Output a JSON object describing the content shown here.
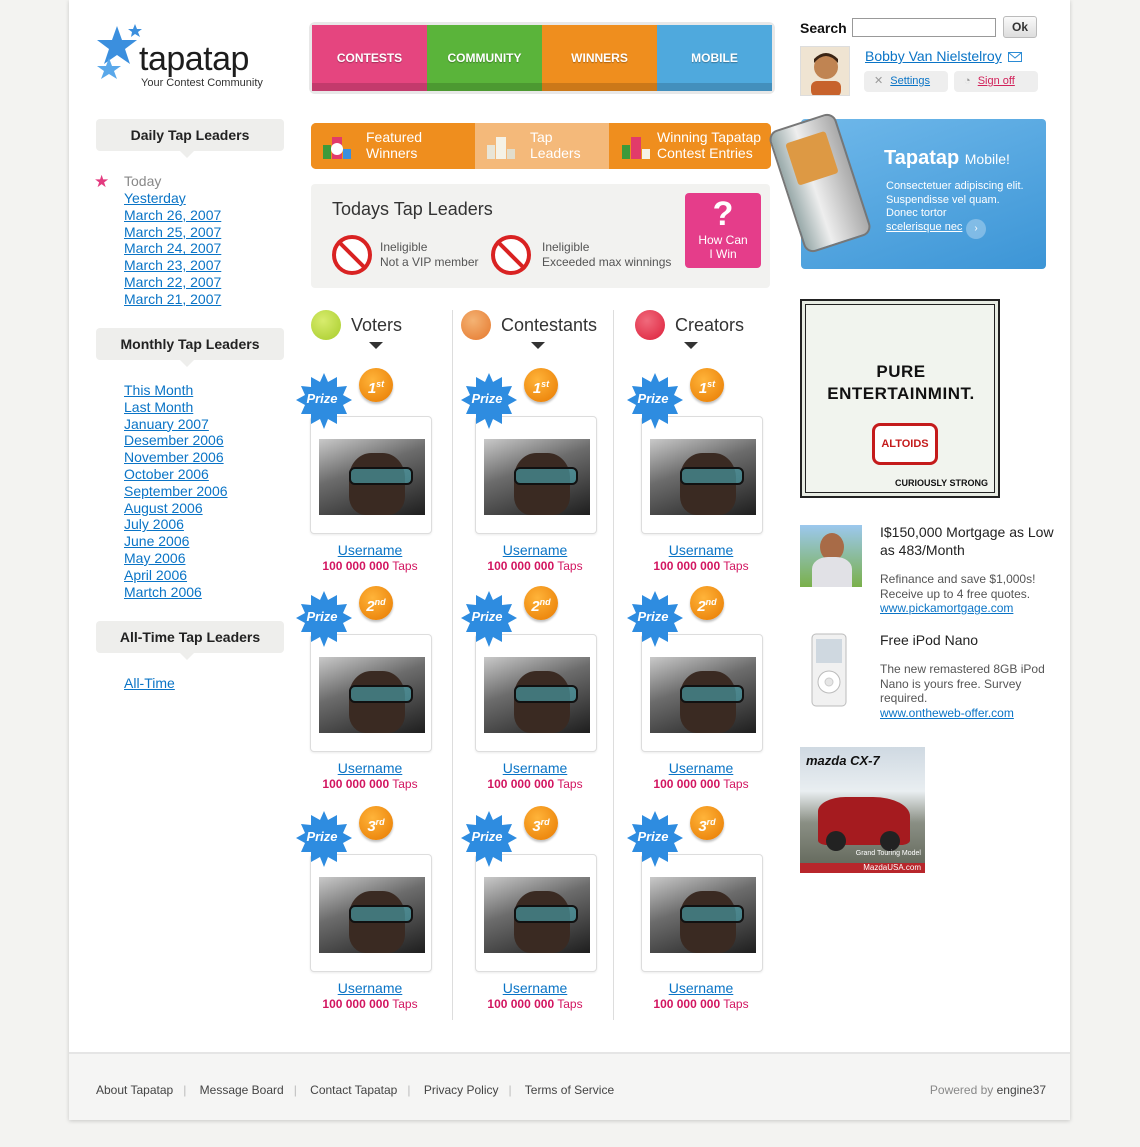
{
  "brand": {
    "name": "tapatap",
    "tagline": "Your Contest Community"
  },
  "nav": {
    "tabs": [
      {
        "label": "CONTESTS",
        "color": "#e5457f"
      },
      {
        "label": "COMMUNITY",
        "color": "#5ab43a"
      },
      {
        "label": "WINNERS",
        "color": "#ef8e1e"
      },
      {
        "label": "MOBILE",
        "color": "#4fa9dd"
      }
    ]
  },
  "header": {
    "search_label": "Search",
    "search_value": "",
    "ok_label": "Ok",
    "user_name": "Bobby Van Nielstelroy",
    "settings_label": "Settings",
    "signoff_label": "Sign off"
  },
  "sidebar": {
    "daily": {
      "title": "Daily Tap Leaders",
      "today": "Today",
      "links": [
        "Yesterday",
        "March 26, 2007",
        "March 25, 2007",
        "March 24, 2007",
        "March 23, 2007",
        "March 22, 2007",
        "March 21, 2007"
      ]
    },
    "monthly": {
      "title": "Monthly Tap Leaders",
      "links": [
        "This Month",
        "Last Month",
        "January 2007",
        "Desember 2006",
        "November 2006",
        "October 2006",
        "September 2006",
        "August 2006",
        "July 2006",
        "June 2006",
        "May 2006",
        "April 2006",
        "Martch 2006"
      ]
    },
    "alltime": {
      "title": "All-Time Tap Leaders",
      "links": [
        "All-Time"
      ]
    }
  },
  "subtabs": [
    {
      "line1": "Featured",
      "line2": "Winners"
    },
    {
      "line1": "Tap",
      "line2": "Leaders"
    },
    {
      "line1": "Winning Tapatap",
      "line2": "Contest Entries"
    }
  ],
  "todays": {
    "title": "Todays Tap Leaders",
    "items": [
      {
        "line1": "Ineligible",
        "line2": "Not a VIP member"
      },
      {
        "line1": "Ineligible",
        "line2": "Exceeded max winnings"
      }
    ],
    "how_q": "?",
    "how_line1": "How Can",
    "how_line2": "I Win"
  },
  "columns": [
    {
      "title": "Voters",
      "color": "#a7cc2a"
    },
    {
      "title": "Contestants",
      "color": "#e5772c"
    },
    {
      "title": "Creators",
      "color": "#dd1f3a"
    }
  ],
  "entry": {
    "prize": "Prize",
    "username": "Username",
    "taps_value": "100 000 000",
    "taps_unit": "Taps",
    "places": [
      {
        "num": "1",
        "suffix": "st"
      },
      {
        "num": "2",
        "suffix": "nd"
      },
      {
        "num": "3",
        "suffix": "rd"
      }
    ]
  },
  "mobile_promo": {
    "title": "Tapatap",
    "title_suffix": "Mobile!",
    "line1": "Consectetuer adipiscing elit.",
    "line2": "Suspendisse vel quam.",
    "line3": "Donec tortor",
    "link": "scelerisque nec"
  },
  "altoids_ad": {
    "headline1": "PURE",
    "headline2": "ENTERTAINMINT.",
    "brand": "ALTOIDS",
    "footer": "CURIOUSLY STRONG"
  },
  "ads": [
    {
      "title": "I$150,000 Mortgage as Low as 483/Month",
      "body": "Refinance and save $1,000s! Receive up to 4 free quotes.",
      "link": "www.pickamortgage.com"
    },
    {
      "title": "Free iPod Nano",
      "body": "The new remastered 8GB iPod Nano is yours free. Survey required.",
      "link": "www.ontheweb-offer.com"
    }
  ],
  "mazda_ad": {
    "brand": "mazda CX-7",
    "caption": "Grand Touring Model",
    "url": "MazdaUSA.com"
  },
  "footer": {
    "links": [
      "About Tapatap",
      "Message Board",
      "Contact Tapatap",
      "Privacy Policy",
      "Terms of Service"
    ],
    "powered_prefix": "Powered by",
    "powered_name": "engine37"
  }
}
